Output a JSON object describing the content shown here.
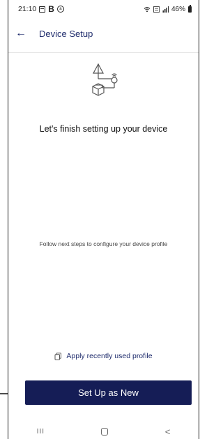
{
  "status_bar": {
    "time": "21:10",
    "notification_b": "B",
    "circle_icon_text": "a",
    "right_text": "46%"
  },
  "header": {
    "back_icon": "←",
    "title": "Device Setup"
  },
  "illustration": {
    "icon": "device-setup-icon"
  },
  "content": {
    "headline": "Let's finish setting up your device",
    "subtext": "Follow next steps to configure your device profile"
  },
  "actions": {
    "apply_recent_label": "Apply recently used profile",
    "primary_label": "Set Up as New"
  },
  "nav": {
    "recents": "III",
    "back": "<"
  },
  "colors": {
    "primary": "#151d56",
    "header_text": "#1d2a6b"
  }
}
